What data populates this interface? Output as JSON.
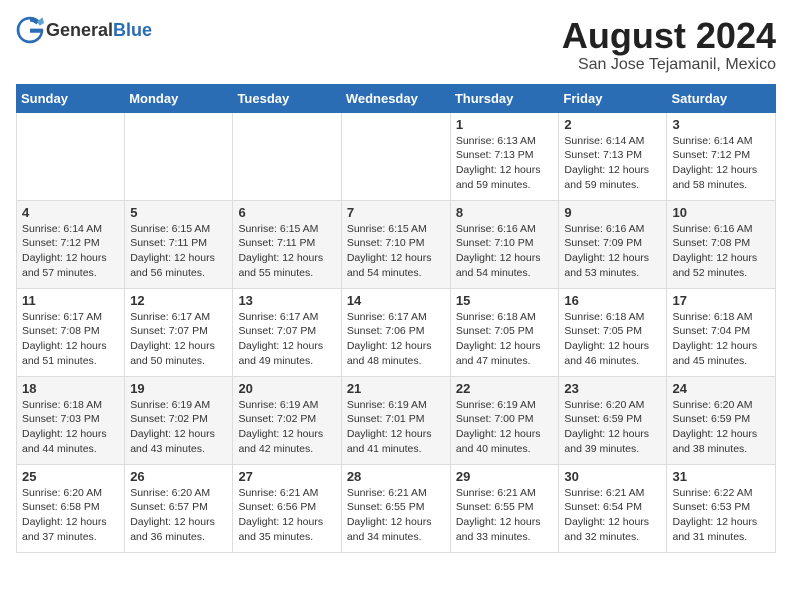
{
  "header": {
    "logo_general": "General",
    "logo_blue": "Blue",
    "title": "August 2024",
    "subtitle": "San Jose Tejamanil, Mexico"
  },
  "days_of_week": [
    "Sunday",
    "Monday",
    "Tuesday",
    "Wednesday",
    "Thursday",
    "Friday",
    "Saturday"
  ],
  "weeks": [
    [
      {
        "day": "",
        "sunrise": "",
        "sunset": "",
        "daylight": ""
      },
      {
        "day": "",
        "sunrise": "",
        "sunset": "",
        "daylight": ""
      },
      {
        "day": "",
        "sunrise": "",
        "sunset": "",
        "daylight": ""
      },
      {
        "day": "",
        "sunrise": "",
        "sunset": "",
        "daylight": ""
      },
      {
        "day": "1",
        "sunrise": "Sunrise: 6:13 AM",
        "sunset": "Sunset: 7:13 PM",
        "daylight": "Daylight: 12 hours and 59 minutes."
      },
      {
        "day": "2",
        "sunrise": "Sunrise: 6:14 AM",
        "sunset": "Sunset: 7:13 PM",
        "daylight": "Daylight: 12 hours and 59 minutes."
      },
      {
        "day": "3",
        "sunrise": "Sunrise: 6:14 AM",
        "sunset": "Sunset: 7:12 PM",
        "daylight": "Daylight: 12 hours and 58 minutes."
      }
    ],
    [
      {
        "day": "4",
        "sunrise": "Sunrise: 6:14 AM",
        "sunset": "Sunset: 7:12 PM",
        "daylight": "Daylight: 12 hours and 57 minutes."
      },
      {
        "day": "5",
        "sunrise": "Sunrise: 6:15 AM",
        "sunset": "Sunset: 7:11 PM",
        "daylight": "Daylight: 12 hours and 56 minutes."
      },
      {
        "day": "6",
        "sunrise": "Sunrise: 6:15 AM",
        "sunset": "Sunset: 7:11 PM",
        "daylight": "Daylight: 12 hours and 55 minutes."
      },
      {
        "day": "7",
        "sunrise": "Sunrise: 6:15 AM",
        "sunset": "Sunset: 7:10 PM",
        "daylight": "Daylight: 12 hours and 54 minutes."
      },
      {
        "day": "8",
        "sunrise": "Sunrise: 6:16 AM",
        "sunset": "Sunset: 7:10 PM",
        "daylight": "Daylight: 12 hours and 54 minutes."
      },
      {
        "day": "9",
        "sunrise": "Sunrise: 6:16 AM",
        "sunset": "Sunset: 7:09 PM",
        "daylight": "Daylight: 12 hours and 53 minutes."
      },
      {
        "day": "10",
        "sunrise": "Sunrise: 6:16 AM",
        "sunset": "Sunset: 7:08 PM",
        "daylight": "Daylight: 12 hours and 52 minutes."
      }
    ],
    [
      {
        "day": "11",
        "sunrise": "Sunrise: 6:17 AM",
        "sunset": "Sunset: 7:08 PM",
        "daylight": "Daylight: 12 hours and 51 minutes."
      },
      {
        "day": "12",
        "sunrise": "Sunrise: 6:17 AM",
        "sunset": "Sunset: 7:07 PM",
        "daylight": "Daylight: 12 hours and 50 minutes."
      },
      {
        "day": "13",
        "sunrise": "Sunrise: 6:17 AM",
        "sunset": "Sunset: 7:07 PM",
        "daylight": "Daylight: 12 hours and 49 minutes."
      },
      {
        "day": "14",
        "sunrise": "Sunrise: 6:17 AM",
        "sunset": "Sunset: 7:06 PM",
        "daylight": "Daylight: 12 hours and 48 minutes."
      },
      {
        "day": "15",
        "sunrise": "Sunrise: 6:18 AM",
        "sunset": "Sunset: 7:05 PM",
        "daylight": "Daylight: 12 hours and 47 minutes."
      },
      {
        "day": "16",
        "sunrise": "Sunrise: 6:18 AM",
        "sunset": "Sunset: 7:05 PM",
        "daylight": "Daylight: 12 hours and 46 minutes."
      },
      {
        "day": "17",
        "sunrise": "Sunrise: 6:18 AM",
        "sunset": "Sunset: 7:04 PM",
        "daylight": "Daylight: 12 hours and 45 minutes."
      }
    ],
    [
      {
        "day": "18",
        "sunrise": "Sunrise: 6:18 AM",
        "sunset": "Sunset: 7:03 PM",
        "daylight": "Daylight: 12 hours and 44 minutes."
      },
      {
        "day": "19",
        "sunrise": "Sunrise: 6:19 AM",
        "sunset": "Sunset: 7:02 PM",
        "daylight": "Daylight: 12 hours and 43 minutes."
      },
      {
        "day": "20",
        "sunrise": "Sunrise: 6:19 AM",
        "sunset": "Sunset: 7:02 PM",
        "daylight": "Daylight: 12 hours and 42 minutes."
      },
      {
        "day": "21",
        "sunrise": "Sunrise: 6:19 AM",
        "sunset": "Sunset: 7:01 PM",
        "daylight": "Daylight: 12 hours and 41 minutes."
      },
      {
        "day": "22",
        "sunrise": "Sunrise: 6:19 AM",
        "sunset": "Sunset: 7:00 PM",
        "daylight": "Daylight: 12 hours and 40 minutes."
      },
      {
        "day": "23",
        "sunrise": "Sunrise: 6:20 AM",
        "sunset": "Sunset: 6:59 PM",
        "daylight": "Daylight: 12 hours and 39 minutes."
      },
      {
        "day": "24",
        "sunrise": "Sunrise: 6:20 AM",
        "sunset": "Sunset: 6:59 PM",
        "daylight": "Daylight: 12 hours and 38 minutes."
      }
    ],
    [
      {
        "day": "25",
        "sunrise": "Sunrise: 6:20 AM",
        "sunset": "Sunset: 6:58 PM",
        "daylight": "Daylight: 12 hours and 37 minutes."
      },
      {
        "day": "26",
        "sunrise": "Sunrise: 6:20 AM",
        "sunset": "Sunset: 6:57 PM",
        "daylight": "Daylight: 12 hours and 36 minutes."
      },
      {
        "day": "27",
        "sunrise": "Sunrise: 6:21 AM",
        "sunset": "Sunset: 6:56 PM",
        "daylight": "Daylight: 12 hours and 35 minutes."
      },
      {
        "day": "28",
        "sunrise": "Sunrise: 6:21 AM",
        "sunset": "Sunset: 6:55 PM",
        "daylight": "Daylight: 12 hours and 34 minutes."
      },
      {
        "day": "29",
        "sunrise": "Sunrise: 6:21 AM",
        "sunset": "Sunset: 6:55 PM",
        "daylight": "Daylight: 12 hours and 33 minutes."
      },
      {
        "day": "30",
        "sunrise": "Sunrise: 6:21 AM",
        "sunset": "Sunset: 6:54 PM",
        "daylight": "Daylight: 12 hours and 32 minutes."
      },
      {
        "day": "31",
        "sunrise": "Sunrise: 6:22 AM",
        "sunset": "Sunset: 6:53 PM",
        "daylight": "Daylight: 12 hours and 31 minutes."
      }
    ]
  ]
}
